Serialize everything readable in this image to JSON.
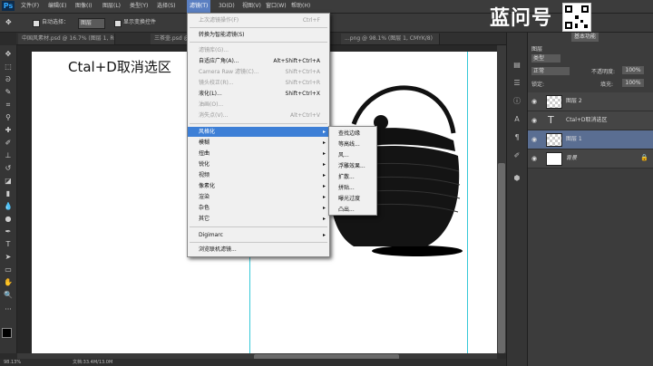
{
  "app": {
    "logo": "Ps"
  },
  "menubar": [
    {
      "label": "文件(F)"
    },
    {
      "label": "编辑(E)"
    },
    {
      "label": "图像(I)"
    },
    {
      "label": "图层(L)"
    },
    {
      "label": "类型(Y)"
    },
    {
      "label": "选择(S)"
    },
    {
      "label": "滤镜(T)",
      "active": true
    },
    {
      "label": "3D(D)"
    },
    {
      "label": "视图(V)"
    },
    {
      "label": "窗口(W)"
    },
    {
      "label": "帮助(H)"
    }
  ],
  "options": {
    "auto_select": "自动选择：",
    "layer_mode": "图层",
    "show_transform": "显示变换控件"
  },
  "tabs": [
    {
      "label": "中国风素材.psd @ 16.7% (图层 1, RGB/8)"
    },
    {
      "label": "三茶壶.psd @ 66.7% (RGB/8#)"
    },
    {
      "label": "...png @ 98.1% (图层 1, CMYK/8)"
    }
  ],
  "canvas": {
    "text": "Ctal+D取消选区"
  },
  "filter_menu": {
    "items": [
      {
        "label": "上次滤镜操作(F)",
        "shortcut": "Ctrl+F",
        "disabled": true
      },
      {
        "sep": true
      },
      {
        "label": "转换为智能滤镜(S)"
      },
      {
        "sep": true
      },
      {
        "label": "滤镜库(G)...",
        "disabled": true
      },
      {
        "label": "自适应广角(A)...",
        "shortcut": "Alt+Shift+Ctrl+A"
      },
      {
        "label": "Camera Raw 滤镜(C)...",
        "shortcut": "Shift+Ctrl+A",
        "disabled": true
      },
      {
        "label": "镜头校正(R)...",
        "shortcut": "Shift+Ctrl+R",
        "disabled": true
      },
      {
        "label": "液化(L)...",
        "shortcut": "Shift+Ctrl+X"
      },
      {
        "label": "油画(O)...",
        "disabled": true
      },
      {
        "label": "消失点(V)...",
        "shortcut": "Alt+Ctrl+V",
        "disabled": true
      },
      {
        "sep": true
      },
      {
        "label": "风格化",
        "submenu": true,
        "highlight": true
      },
      {
        "label": "模糊",
        "submenu": true
      },
      {
        "label": "扭曲",
        "submenu": true
      },
      {
        "label": "锐化",
        "submenu": true
      },
      {
        "label": "视频",
        "submenu": true
      },
      {
        "label": "像素化",
        "submenu": true
      },
      {
        "label": "渲染",
        "submenu": true
      },
      {
        "label": "杂色",
        "submenu": true
      },
      {
        "label": "其它",
        "submenu": true
      },
      {
        "sep": true
      },
      {
        "label": "Digimarc",
        "submenu": true
      },
      {
        "sep": true
      },
      {
        "label": "浏览联机滤镜..."
      }
    ]
  },
  "stylize_submenu": [
    "查找边缘",
    "等高线...",
    "风...",
    "浮雕效果...",
    "扩散...",
    "拼贴...",
    "曝光过度",
    "凸出..."
  ],
  "layers_panel": {
    "tab": "图层",
    "kind": "类型",
    "blend_mode": "正常",
    "opacity_label": "不透明度:",
    "opacity": "100%",
    "lock_label": "锁定:",
    "fill_label": "填充:",
    "fill": "100%",
    "layers": [
      {
        "name": "图层 2",
        "thumb": "checker"
      },
      {
        "name": "Ctal+D取消选区",
        "thumb": "text"
      },
      {
        "name": "图层 1",
        "thumb": "checker",
        "selected": true
      },
      {
        "name": "背景",
        "thumb": "white",
        "locked": true
      }
    ]
  },
  "workspace": {
    "label": "基本功能"
  },
  "statusbar": {
    "zoom": "98.13%",
    "doc": "文档:33.4M/13.0M"
  },
  "watermark": {
    "text": "蓝问号"
  },
  "colors": {
    "menu_highlight": "#3d7fd6",
    "selected_layer": "#5a6e92",
    "guide": "#34c8d8"
  }
}
